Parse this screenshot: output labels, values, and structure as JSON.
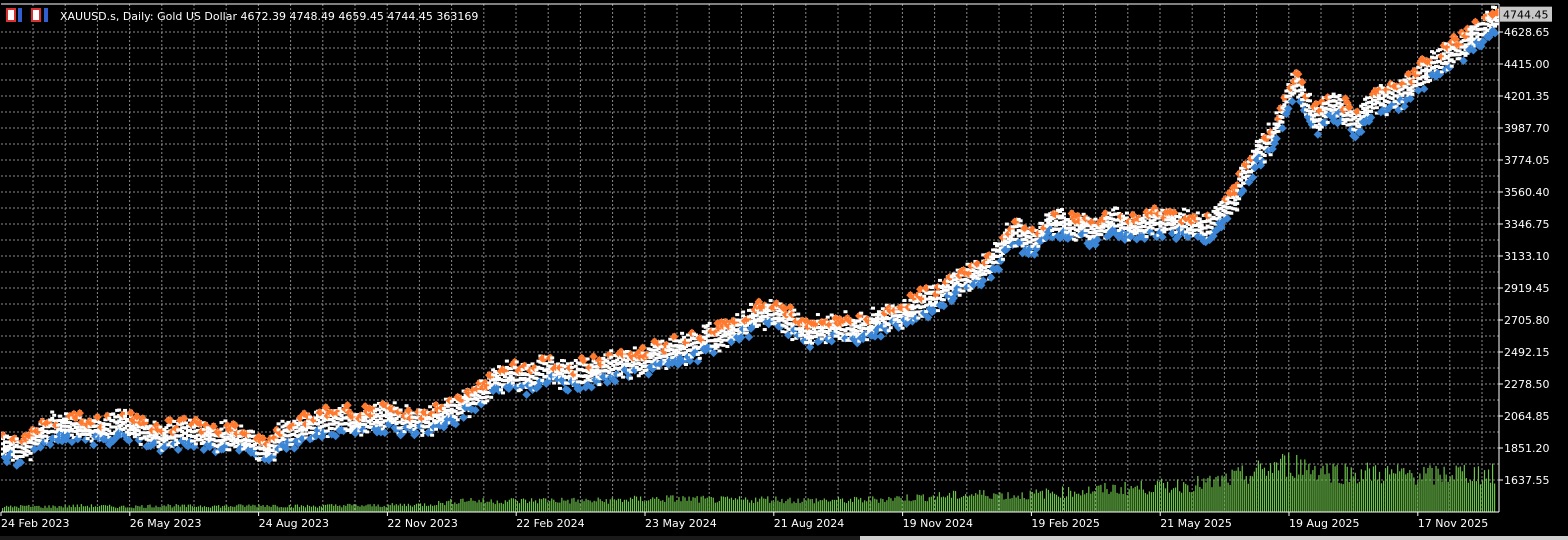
{
  "window": {
    "symbol_info": "XAUUSD.s, Daily:  Gold US Dollar  4672.39 4748.49 4659.45 4744.45  363169",
    "current_price_label": "4744.45"
  },
  "icons": [
    "window-controls-icon"
  ],
  "colors": {
    "background": "#000000",
    "grid": "#8a8a8a",
    "axis": "#ffffff",
    "text": "#ffffff",
    "bull_marker": "#3b86d6",
    "bear_marker": "#ff7a2e",
    "marker_body": "#ffffff",
    "volume": "#6cc24a",
    "price_label_bg": "#c8c8c8"
  },
  "chart_data": {
    "type": "scatter",
    "description_series": [
      "price markers",
      "volume"
    ],
    "y_ticks": [
      "4628.65",
      "4415.00",
      "4201.35",
      "3987.70",
      "3774.05",
      "3560.40",
      "3346.75",
      "3133.10",
      "2919.45",
      "2705.80",
      "2492.15",
      "2278.50",
      "2064.85",
      "1851.20",
      "1637.55"
    ],
    "y_tick_values": [
      4628.65,
      4415.0,
      4201.35,
      3987.7,
      3774.05,
      3560.4,
      3346.75,
      3133.1,
      2919.45,
      2705.8,
      2492.15,
      2278.5,
      2064.85,
      1851.2,
      1637.55
    ],
    "x_ticks": [
      "24 Feb 2023",
      "26 May 2023",
      "24 Aug 2023",
      "22 Nov 2023",
      "22 Feb 2024",
      "23 May 2024",
      "21 Aug 2024",
      "19 Nov 2024",
      "19 Feb 2025",
      "21 May 2025",
      "19 Aug 2025",
      "17 Nov 2025"
    ],
    "ylim": [
      1600,
      4780
    ],
    "price_path": [
      [
        0,
        1880
      ],
      [
        3,
        1840
      ],
      [
        6,
        1960
      ],
      [
        9,
        2000
      ],
      [
        12,
        1990
      ],
      [
        15,
        1980
      ],
      [
        18,
        2010
      ],
      [
        21,
        1960
      ],
      [
        24,
        1930
      ],
      [
        27,
        1960
      ],
      [
        30,
        1940
      ],
      [
        33,
        1920
      ],
      [
        36,
        1930
      ],
      [
        39,
        1820
      ],
      [
        42,
        1950
      ],
      [
        45,
        2000
      ],
      [
        48,
        2020
      ],
      [
        51,
        2040
      ],
      [
        54,
        2030
      ],
      [
        57,
        2060
      ],
      [
        60,
        2040
      ],
      [
        63,
        2020
      ],
      [
        66,
        2090
      ],
      [
        69,
        2160
      ],
      [
        72,
        2250
      ],
      [
        75,
        2350
      ],
      [
        78,
        2320
      ],
      [
        81,
        2380
      ],
      [
        84,
        2330
      ],
      [
        87,
        2360
      ],
      [
        90,
        2390
      ],
      [
        93,
        2420
      ],
      [
        96,
        2450
      ],
      [
        99,
        2500
      ],
      [
        102,
        2520
      ],
      [
        105,
        2580
      ],
      [
        108,
        2640
      ],
      [
        111,
        2700
      ],
      [
        114,
        2760
      ],
      [
        117,
        2700
      ],
      [
        120,
        2620
      ],
      [
        123,
        2660
      ],
      [
        126,
        2640
      ],
      [
        129,
        2680
      ],
      [
        132,
        2720
      ],
      [
        135,
        2780
      ],
      [
        138,
        2840
      ],
      [
        141,
        2940
      ],
      [
        144,
        3000
      ],
      [
        147,
        3080
      ],
      [
        150,
        3300
      ],
      [
        153,
        3230
      ],
      [
        156,
        3360
      ],
      [
        159,
        3340
      ],
      [
        162,
        3310
      ],
      [
        165,
        3360
      ],
      [
        168,
        3330
      ],
      [
        171,
        3380
      ],
      [
        174,
        3360
      ],
      [
        177,
        3320
      ],
      [
        180,
        3350
      ],
      [
        183,
        3520
      ],
      [
        186,
        3800
      ],
      [
        189,
        3950
      ],
      [
        192,
        4300
      ],
      [
        195,
        4050
      ],
      [
        198,
        4150
      ],
      [
        201,
        4020
      ],
      [
        204,
        4180
      ],
      [
        207,
        4200
      ],
      [
        210,
        4310
      ],
      [
        213,
        4420
      ],
      [
        216,
        4520
      ],
      [
        219,
        4600
      ],
      [
        222,
        4744.45
      ]
    ],
    "path_x_max": 222,
    "volume_level": [
      0.1,
      0.12,
      0.11,
      0.12,
      0.13,
      0.12,
      0.11,
      0.12,
      0.14,
      0.12,
      0.13,
      0.12,
      0.13,
      0.14,
      0.13,
      0.12,
      0.13,
      0.14,
      0.13,
      0.14,
      0.15,
      0.16,
      0.2,
      0.26,
      0.22,
      0.24,
      0.23,
      0.25,
      0.24,
      0.23,
      0.24,
      0.26,
      0.27,
      0.28,
      0.27,
      0.26,
      0.25,
      0.26,
      0.27,
      0.25,
      0.24,
      0.25,
      0.24,
      0.26,
      0.28,
      0.3,
      0.32,
      0.34,
      0.36,
      0.38,
      0.34,
      0.36,
      0.4,
      0.42,
      0.45,
      0.48,
      0.5,
      0.52,
      0.55,
      0.58,
      0.6,
      0.7,
      0.8,
      0.95,
      1.0,
      0.92,
      0.85,
      0.8,
      0.82,
      0.78,
      0.8,
      0.75,
      0.82,
      0.8,
      0.78
    ],
    "last_price": 4744.45,
    "grid": true
  }
}
